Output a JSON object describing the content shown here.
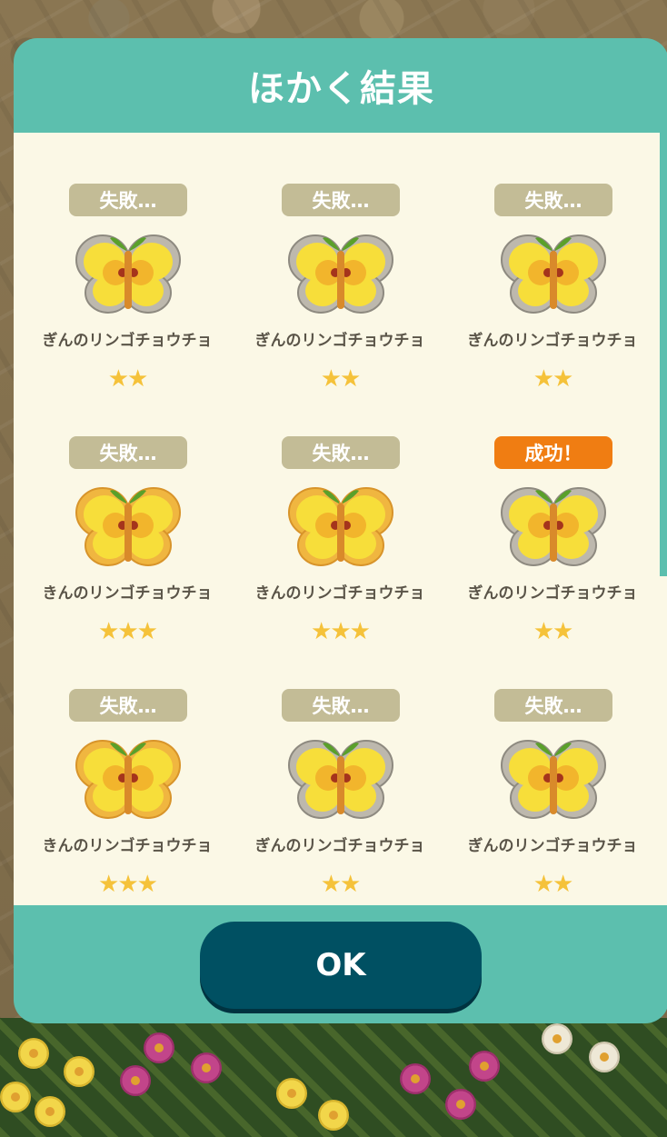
{
  "dialog": {
    "title": "ほかく結果",
    "ok_label": "OK"
  },
  "colors": {
    "dialog_teal": "#5cbfae",
    "panel_cream": "#fbf8e6",
    "fail_badge": "#c3bc96",
    "success_badge": "#f07d12",
    "ok_button": "#005062",
    "star": "#f5c23a"
  },
  "results": [
    {
      "status": "失敗…",
      "success": false,
      "name": "ぎんのリンゴチョウチョ",
      "stars": "★★",
      "variant": "silver"
    },
    {
      "status": "失敗…",
      "success": false,
      "name": "ぎんのリンゴチョウチョ",
      "stars": "★★",
      "variant": "silver"
    },
    {
      "status": "失敗…",
      "success": false,
      "name": "ぎんのリンゴチョウチョ",
      "stars": "★★",
      "variant": "silver"
    },
    {
      "status": "失敗…",
      "success": false,
      "name": "きんのリンゴチョウチョ",
      "stars": "★★★",
      "variant": "gold"
    },
    {
      "status": "失敗…",
      "success": false,
      "name": "きんのリンゴチョウチョ",
      "stars": "★★★",
      "variant": "gold"
    },
    {
      "status": "成功！",
      "success": true,
      "name": "ぎんのリンゴチョウチョ",
      "stars": "★★",
      "variant": "silver"
    },
    {
      "status": "失敗…",
      "success": false,
      "name": "きんのリンゴチョウチョ",
      "stars": "★★★",
      "variant": "gold"
    },
    {
      "status": "失敗…",
      "success": false,
      "name": "ぎんのリンゴチョウチョ",
      "stars": "★★",
      "variant": "silver"
    },
    {
      "status": "失敗…",
      "success": false,
      "name": "ぎんのリンゴチョウチョ",
      "stars": "★★",
      "variant": "silver"
    }
  ]
}
